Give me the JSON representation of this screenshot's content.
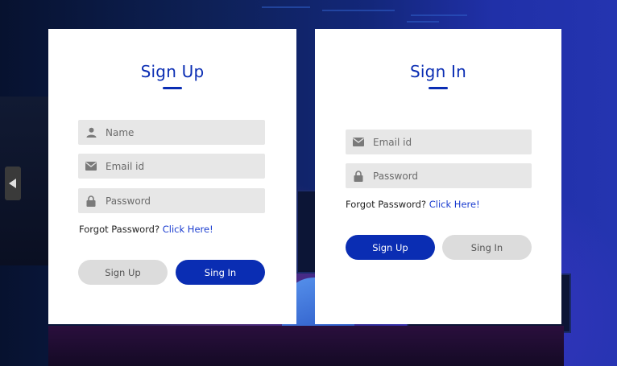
{
  "signup": {
    "title": "Sign Up",
    "fields": {
      "name_placeholder": "Name",
      "email_placeholder": "Email id",
      "password_placeholder": "Password"
    },
    "forgot_text": "Forgot Password?",
    "forgot_link": "Click Here!",
    "buttons": {
      "signup_label": "Sign Up",
      "signin_label": "Sing In"
    }
  },
  "signin": {
    "title": "Sign In",
    "fields": {
      "email_placeholder": "Email id",
      "password_placeholder": "Password"
    },
    "forgot_text": "Forgot Password?",
    "forgot_link": "Click Here!",
    "buttons": {
      "signup_label": "Sign Up",
      "signin_label": "Sing In"
    }
  },
  "icons": {
    "user": "user-icon",
    "email": "envelope-icon",
    "password": "lock-icon",
    "nav": "chevron-left-icon"
  },
  "colors": {
    "primary": "#0a2db3",
    "field_bg": "#e7e7e7",
    "secondary_button": "#dcdcdc",
    "link": "#1a3ccf"
  }
}
